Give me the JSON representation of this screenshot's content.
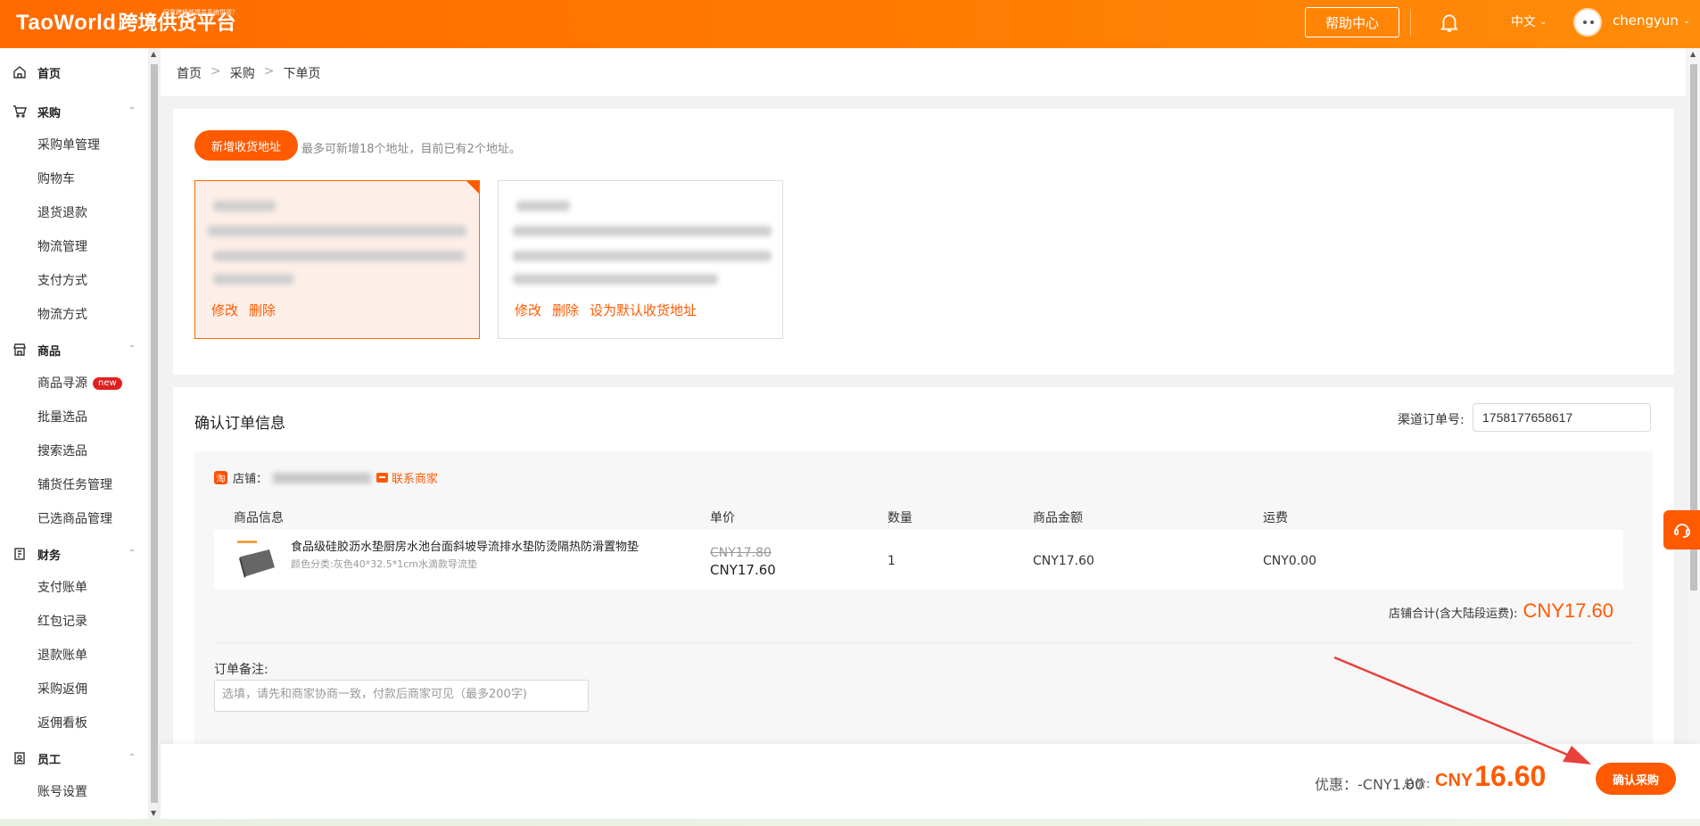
{
  "header": {
    "logo_main": "TaoWorld",
    "logo_cn": "跨境供货平台",
    "logo_tagline": "同意跨境前提并系统供货？",
    "help_label": "帮助中心",
    "language": "中文",
    "username": "chengyun",
    "icons": {
      "bell": "bell-icon",
      "avatar": "avatar"
    }
  },
  "sidebar": {
    "home": "首页",
    "groups": [
      {
        "label": "采购",
        "items": [
          "采购单管理",
          "购物车",
          "退货退款",
          "物流管理",
          "支付方式",
          "物流方式"
        ]
      },
      {
        "label": "商品",
        "items": [
          "商品寻源",
          "批量选品",
          "搜索选品",
          "铺货任务管理",
          "已选商品管理"
        ],
        "new_badge": "new"
      },
      {
        "label": "财务",
        "items": [
          "支付账单",
          "红包记录",
          "退款账单",
          "采购返佣",
          "返佣看板"
        ]
      },
      {
        "label": "员工",
        "items": [
          "账号设置"
        ]
      }
    ]
  },
  "breadcrumb": [
    "首页",
    "采购",
    "下单页"
  ],
  "address": {
    "add_button": "新增收货地址",
    "hint": "最多可新增18个地址，目前已有2个地址。",
    "cards": [
      {
        "actions": [
          "修改",
          "删除"
        ]
      },
      {
        "actions": [
          "修改",
          "删除",
          "设为默认收货地址"
        ]
      }
    ]
  },
  "order": {
    "title": "确认订单信息",
    "channel_label": "渠道订单号:",
    "channel_value": "1758177658617",
    "shop_label": "店铺：",
    "shop_icon_text": "淘",
    "contact_label": "联系商家",
    "columns": [
      "商品信息",
      "单价",
      "数量",
      "商品金额",
      "运费"
    ],
    "item": {
      "name": "食品级硅胶沥水垫厨房水池台面斜坡导流排水垫防烫隔热防滑置物垫",
      "spec": "颜色分类:灰色40*32.5*1cm水滴款导流垫",
      "price_original": "CNY17.80",
      "price_current": "CNY17.60",
      "quantity": "1",
      "amount": "CNY17.60",
      "freight": "CNY0.00"
    },
    "shop_total_label": "店铺合计(含大陆段运费):",
    "shop_total_value": "CNY17.60",
    "note_label": "订单备注:",
    "note_placeholder": "选填，请先和商家协商一致，付款后商家可见（最多200字)"
  },
  "footer": {
    "discount": "优惠：-CNY1.00",
    "total_label": "总价:",
    "total_currency": "CNY",
    "total_value": "16.60",
    "confirm_label": "确认采购"
  },
  "colors": {
    "accent": "#ff5a00",
    "header_gradient": [
      "#ff6a00",
      "#ff8c0a"
    ],
    "arrow": "#e8403a"
  }
}
